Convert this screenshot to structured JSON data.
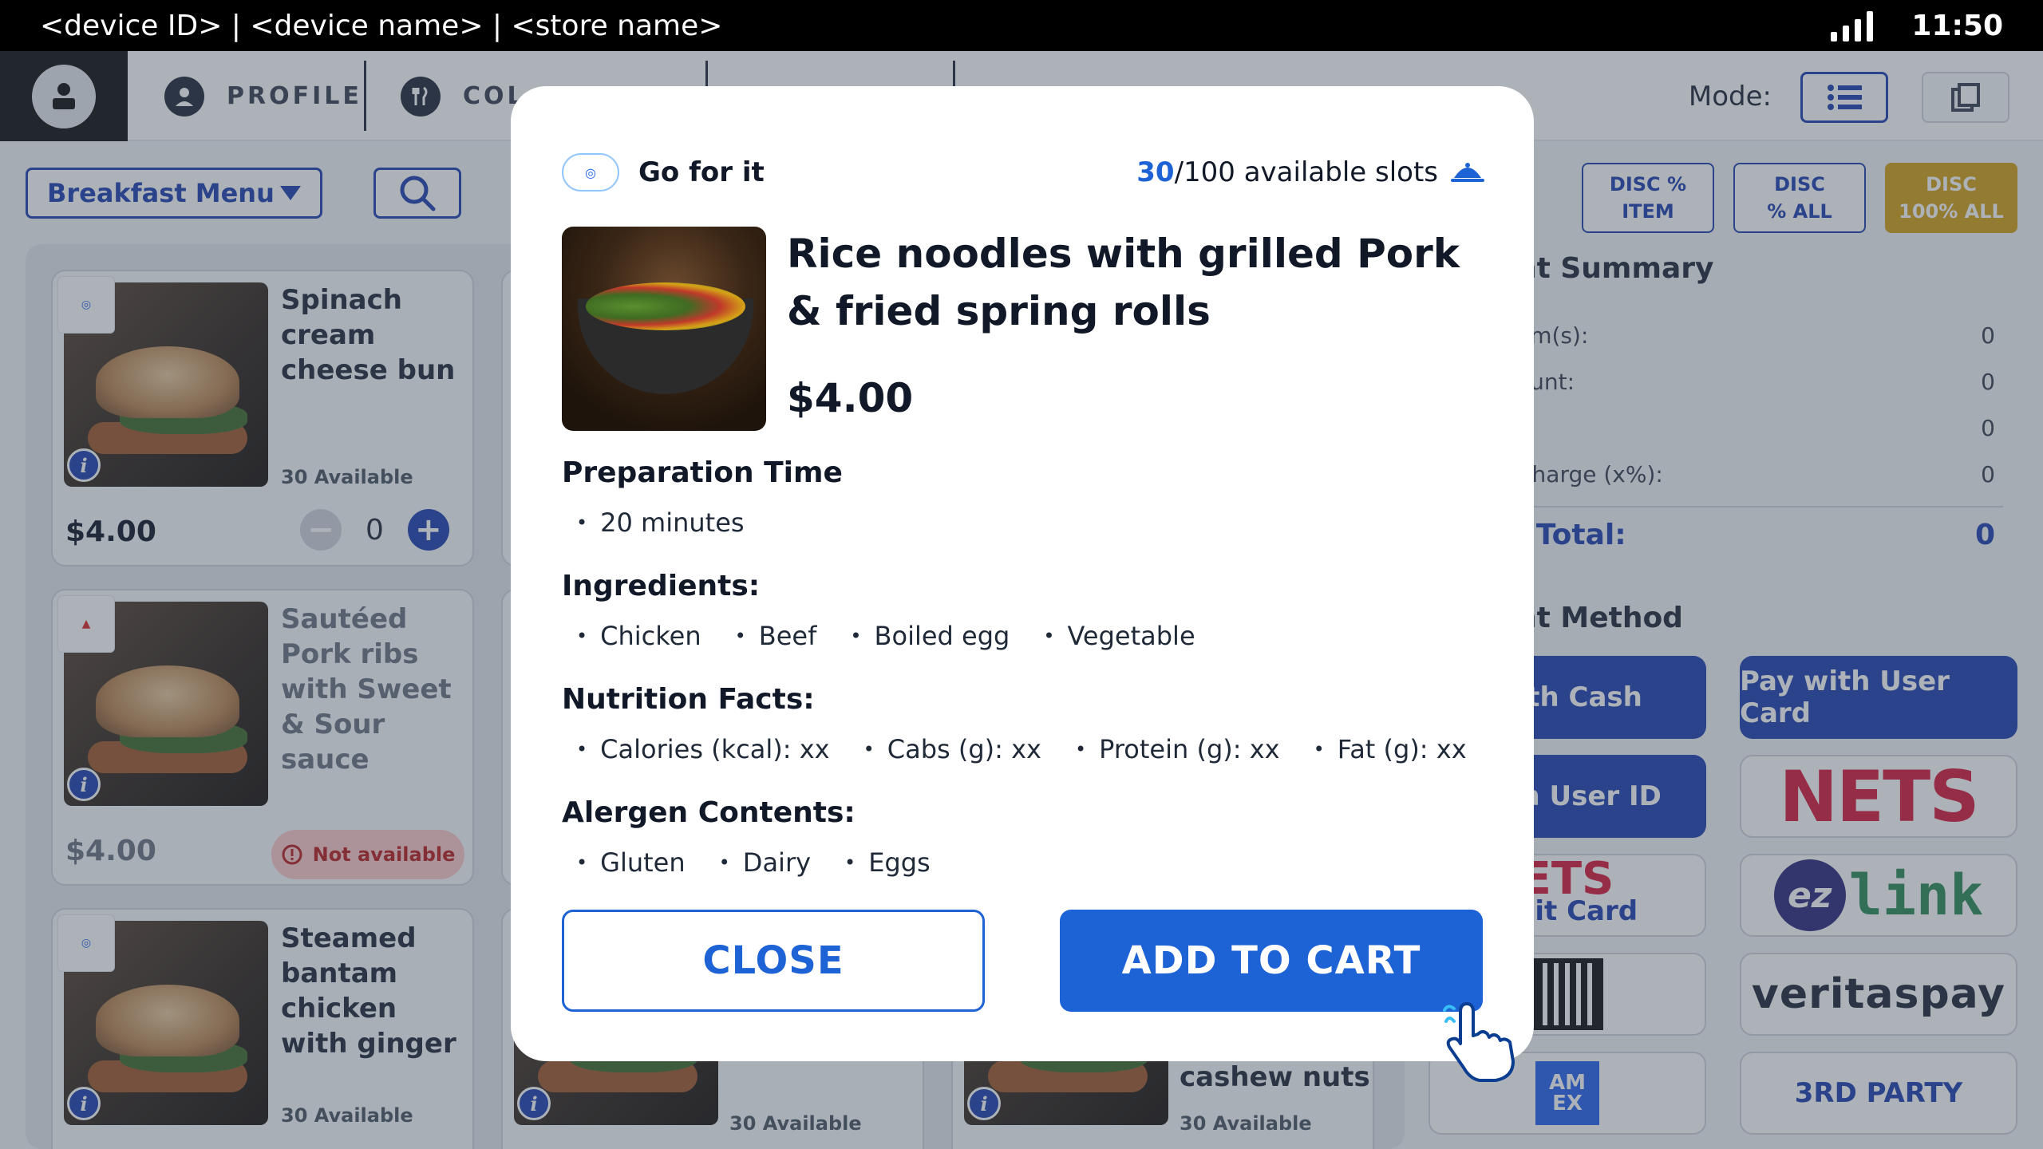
{
  "status_bar": {
    "device_info": "<device ID> | <device name> | <store name>",
    "time": "11:50",
    "signal_icon": "signal-bars-icon"
  },
  "nav": {
    "tabs": [
      {
        "label": "PROFILE",
        "icon": "person-icon"
      },
      {
        "label": "COL",
        "icon": "restaurant-icon"
      }
    ],
    "mode_label": "Mode:"
  },
  "menu": {
    "selected": "Breakfast Menu"
  },
  "items": [
    {
      "name": "Spinach cream cheese bun",
      "availability": "30 Available",
      "price": "$4.00",
      "quantity": "0"
    },
    {
      "name": "Sautéed Pork ribs with Sweet & Sour sauce",
      "price": "$4.00",
      "status": "Not available"
    },
    {
      "name": "Steamed bantam chicken with ginger",
      "availability": "30 Available"
    }
  ],
  "partial_items": {
    "name_fragment": "cashew nuts",
    "availability": "30 Available"
  },
  "discounts": [
    {
      "line1": "DISC %",
      "line2": "ITEM"
    },
    {
      "line1": "DISC",
      "line2": "% ALL"
    },
    {
      "line1": "DISC",
      "line2": "100% ALL"
    }
  ],
  "summary": {
    "title": "nt Summary",
    "rows": [
      {
        "label": "em(s):",
        "value": "0"
      },
      {
        "label": "ount:",
        "value": "0"
      },
      {
        "label": "",
        "value": "0"
      },
      {
        "label": "Charge (x%):",
        "value": "0"
      }
    ],
    "total_label": "l Total:",
    "total_value": "0"
  },
  "payment": {
    "title": "nt Method",
    "cash": "with Cash",
    "user_card": "Pay with User Card",
    "user_id": "with User ID",
    "nets": "NETS",
    "credit_card": "edit Card",
    "credit_card_logo": "ETS",
    "ezlink_prefix": "ez",
    "ezlink": "link",
    "veritas": "veritaspay",
    "amex": "AM EX",
    "third_party": "3RD PARTY"
  },
  "modal": {
    "brand": "Go for it",
    "slots_current": "30",
    "slots_rest": "/100 available slots",
    "title": "Rice noodles with grilled Pork & fried spring rolls",
    "price": "$4.00",
    "prep_title": "Preparation Time",
    "prep": [
      "20 minutes"
    ],
    "ingredients_title": "Ingredients:",
    "ingredients": [
      "Chicken",
      "Beef",
      "Boiled egg",
      "Vegetable"
    ],
    "nutrition_title": "Nutrition Facts:",
    "nutrition": [
      "Calories (kcal): xx",
      "Cabs (g): xx",
      "Protein (g): xx",
      "Fat (g): xx"
    ],
    "allergen_title": "Alergen Contents:",
    "allergens": [
      "Gluten",
      "Dairy",
      "Eggs"
    ],
    "close_label": "CLOSE",
    "add_label": "ADD TO CART"
  },
  "colors": {
    "primary": "#1e63d6",
    "navy": "#1e40af",
    "gold": "#d4a017",
    "danger": "#b91c1c"
  }
}
